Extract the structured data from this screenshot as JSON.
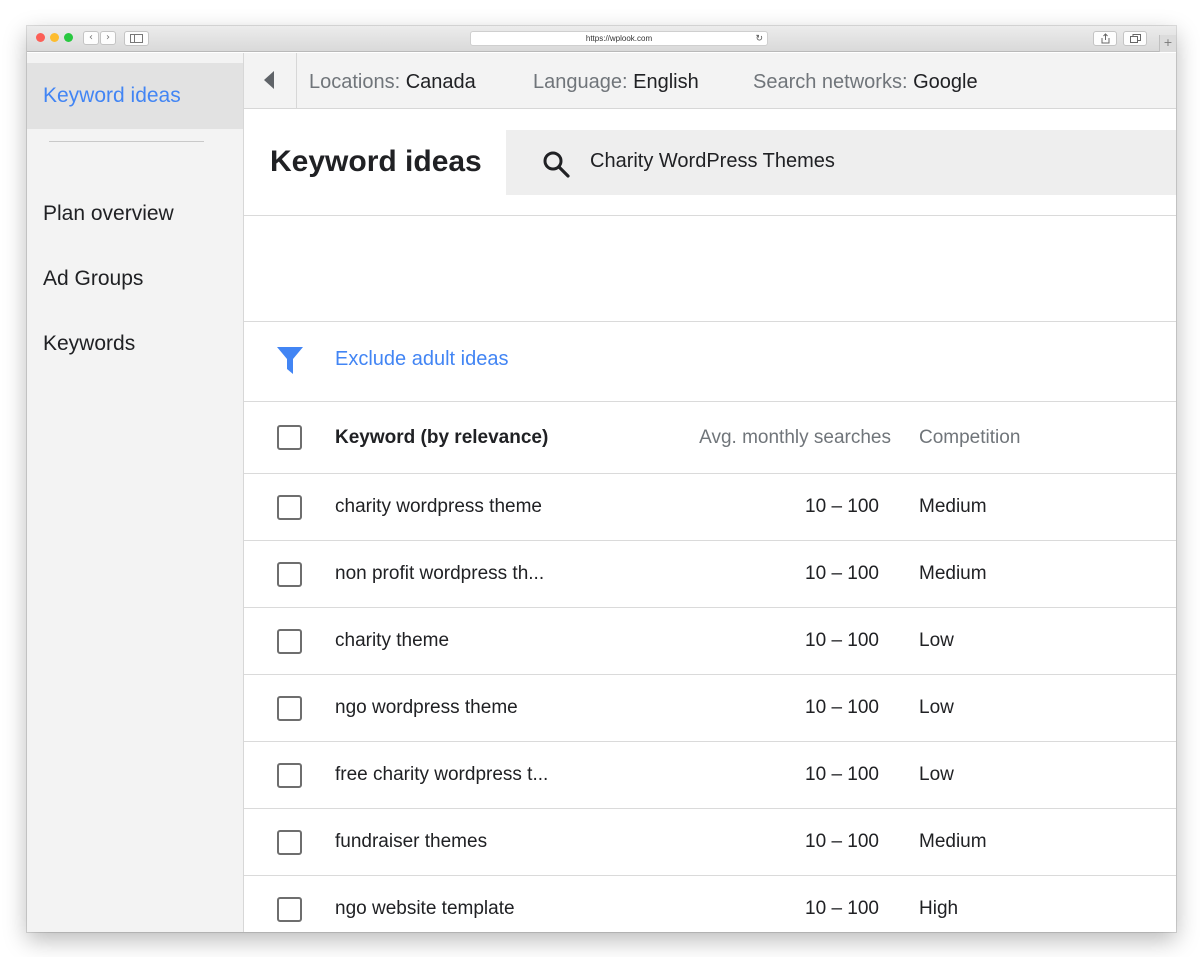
{
  "browser": {
    "url": "https://wplook.com",
    "back_glyph": "‹",
    "forward_glyph": "›",
    "reload_glyph": "↻",
    "new_tab_glyph": "+"
  },
  "sidebar": {
    "active_label": "Keyword ideas",
    "items": [
      {
        "label": "Plan overview"
      },
      {
        "label": "Ad Groups"
      },
      {
        "label": "Keywords"
      }
    ]
  },
  "topbar": {
    "locations": {
      "label": "Locations:",
      "value": "Canada"
    },
    "language": {
      "label": "Language:",
      "value": "English"
    },
    "networks": {
      "label": "Search networks:",
      "value": "Google"
    }
  },
  "main": {
    "title": "Keyword ideas",
    "search_value": "Charity WordPress Themes",
    "exclude_label": "Exclude adult ideas",
    "accent_color": "#4285f4"
  },
  "table": {
    "headers": {
      "keyword": "Keyword (by relevance)",
      "avg": "Avg. monthly searches",
      "competition": "Competition"
    },
    "rows": [
      {
        "keyword": "charity wordpress theme",
        "avg": "10 – 100",
        "competition": "Medium"
      },
      {
        "keyword": "non profit wordpress th...",
        "avg": "10 – 100",
        "competition": "Medium"
      },
      {
        "keyword": "charity theme",
        "avg": "10 – 100",
        "competition": "Low"
      },
      {
        "keyword": "ngo wordpress theme",
        "avg": "10 – 100",
        "competition": "Low"
      },
      {
        "keyword": "free charity wordpress t...",
        "avg": "10 – 100",
        "competition": "Low"
      },
      {
        "keyword": "fundraiser themes",
        "avg": "10 – 100",
        "competition": "Medium"
      },
      {
        "keyword": "ngo website template",
        "avg": "10 – 100",
        "competition": "High"
      }
    ]
  }
}
